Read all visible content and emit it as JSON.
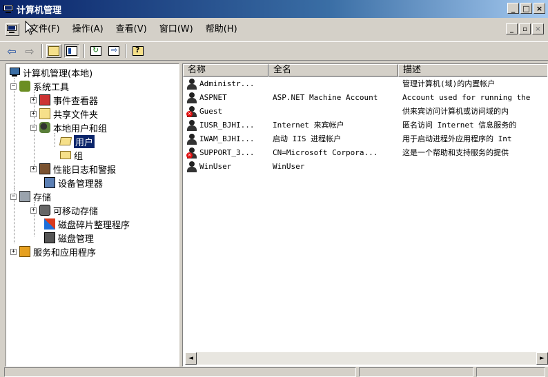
{
  "window": {
    "title": "计算机管理",
    "controls": [
      "_",
      "□",
      "×"
    ]
  },
  "menu": {
    "items": [
      "文件(F)",
      "操作(A)",
      "查看(V)",
      "窗口(W)",
      "帮助(H)"
    ],
    "mdi_controls": [
      "_",
      "▫",
      "×"
    ]
  },
  "toolbar": {
    "icons": [
      "back-icon",
      "forward-icon",
      "up-folder-icon",
      "show-hide-tree-icon",
      "refresh-icon",
      "export-list-icon",
      "help-icon"
    ]
  },
  "tree": {
    "items": [
      {
        "label": "计算机管理(本地)",
        "icon": "computer-icon",
        "expander": ""
      },
      {
        "label": "系统工具",
        "icon": "tools-icon",
        "expander": "−"
      },
      {
        "label": "事件查看器",
        "icon": "event-viewer-icon",
        "expander": "+"
      },
      {
        "label": "共享文件夹",
        "icon": "shared-folder-icon",
        "expander": "+"
      },
      {
        "label": "本地用户和组",
        "icon": "users-groups-icon",
        "expander": "−"
      },
      {
        "label": "用户",
        "icon": "folder-open-icon",
        "expander": ""
      },
      {
        "label": "组",
        "icon": "folder-icon",
        "expander": ""
      },
      {
        "label": "性能日志和警报",
        "icon": "performance-icon",
        "expander": "+"
      },
      {
        "label": "设备管理器",
        "icon": "device-manager-icon",
        "expander": ""
      },
      {
        "label": "存储",
        "icon": "storage-icon",
        "expander": "−"
      },
      {
        "label": "可移动存储",
        "icon": "removable-storage-icon",
        "expander": "+"
      },
      {
        "label": "磁盘碎片整理程序",
        "icon": "defrag-icon",
        "expander": ""
      },
      {
        "label": "磁盘管理",
        "icon": "disk-management-icon",
        "expander": ""
      },
      {
        "label": "服务和应用程序",
        "icon": "services-icon",
        "expander": "+"
      }
    ]
  },
  "list": {
    "columns": [
      "名称",
      "全名",
      "描述"
    ],
    "rows": [
      {
        "name": "Administr...",
        "full": "",
        "desc": "管理计算机(域)的内置帐户",
        "disabled": false
      },
      {
        "name": "ASPNET",
        "full": "ASP.NET Machine Account",
        "desc": "Account used for running the",
        "disabled": false
      },
      {
        "name": "Guest",
        "full": "",
        "desc": "供来宾访问计算机或访问域的内",
        "disabled": true
      },
      {
        "name": "IUSR_BJHI...",
        "full": "Internet 来宾帐户",
        "desc": "匿名访问 Internet 信息服务的",
        "disabled": false
      },
      {
        "name": "IWAM_BJHI...",
        "full": "启动 IIS 进程帐户",
        "desc": "用于启动进程外应用程序的 Int",
        "disabled": false
      },
      {
        "name": "SUPPORT_3...",
        "full": "CN=Microsoft Corpora...",
        "desc": "这是一个帮助和支持服务的提供",
        "disabled": true
      },
      {
        "name": "WinUser",
        "full": "WinUser",
        "desc": "",
        "disabled": false
      }
    ]
  },
  "scrollbar": {
    "left": "◄",
    "right": "►"
  }
}
